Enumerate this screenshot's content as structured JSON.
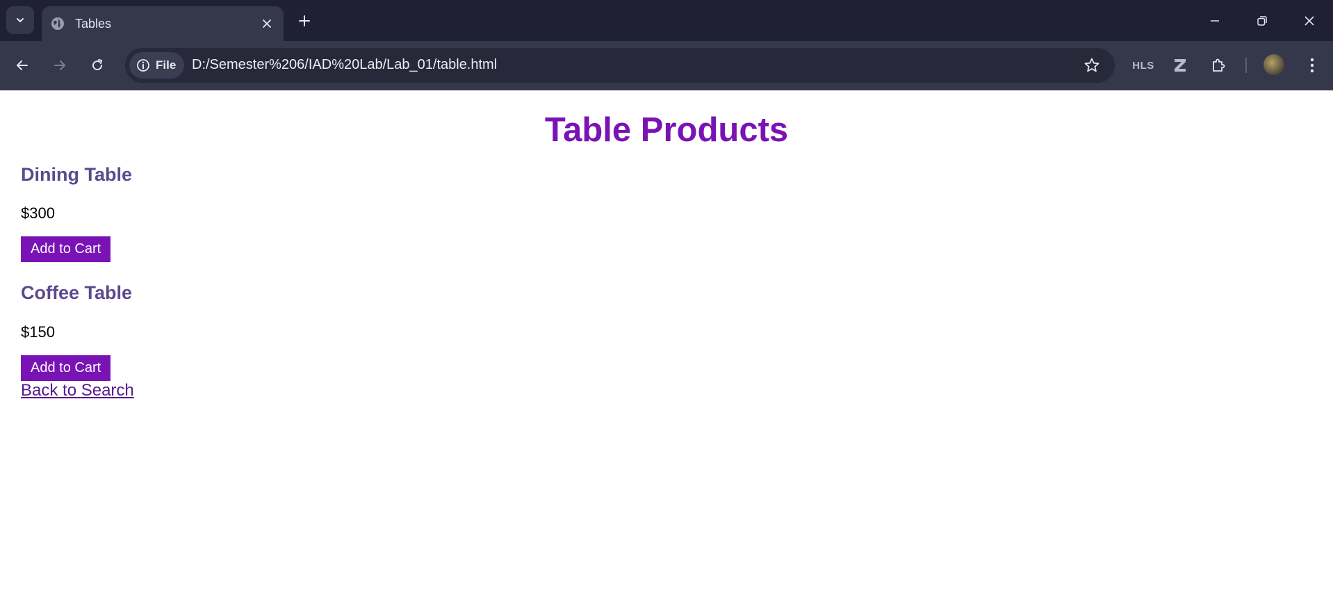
{
  "browser": {
    "tab_title": "Tables",
    "site_chip": "File",
    "url": "D:/Semester%206/IAD%20Lab/Lab_01/table.html",
    "extensions": {
      "hls": "HLS"
    }
  },
  "page": {
    "title": "Table Products",
    "products": [
      {
        "name": "Dining Table",
        "price": "$300",
        "button": "Add to Cart"
      },
      {
        "name": "Coffee Table",
        "price": "$150",
        "button": "Add to Cart"
      }
    ],
    "back_link": "Back to Search"
  },
  "colors": {
    "accent": "#7a13b6",
    "product_heading": "#5b4a8f",
    "link": "#551a8b",
    "chrome_dark": "#1f2033",
    "chrome_toolbar": "#35374b"
  }
}
